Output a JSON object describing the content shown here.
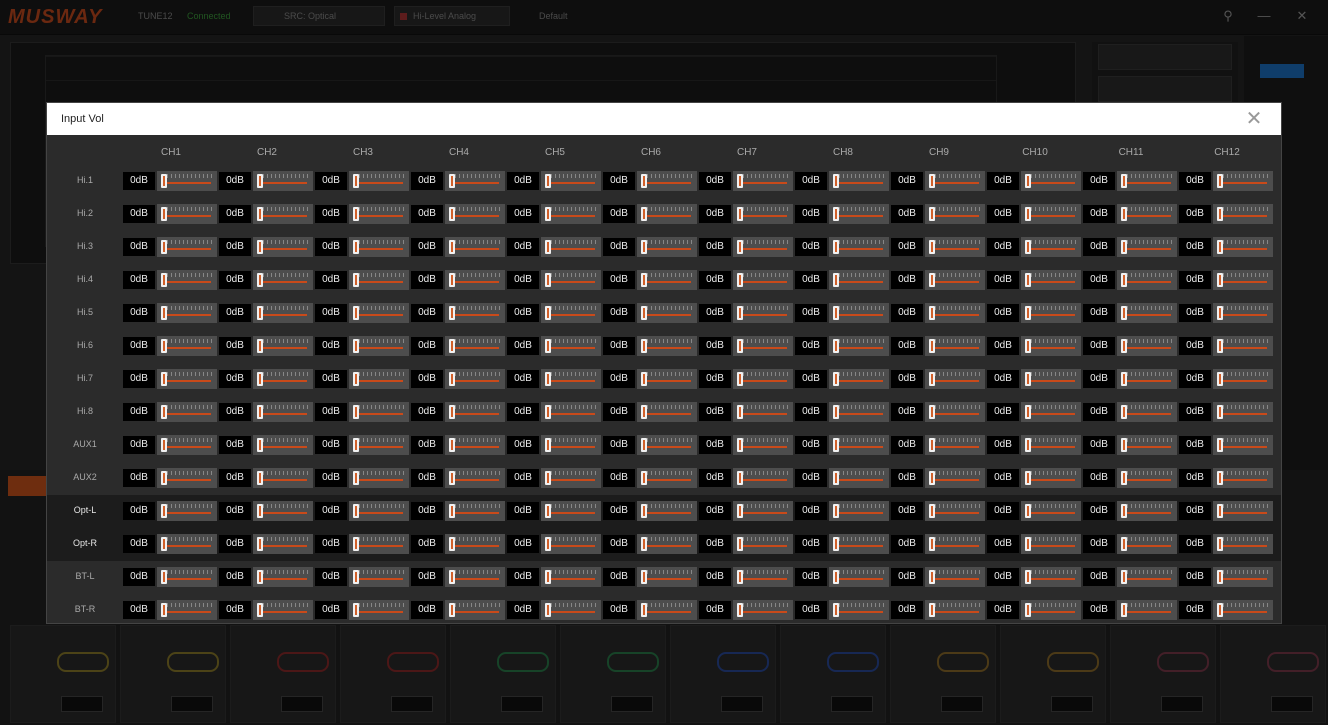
{
  "app": {
    "logo": "MUSWAY",
    "model": "TUNE12",
    "status": "Connected",
    "source": "SRC: Optical",
    "link": "Hi-Level Analog",
    "preset": "Default",
    "colors": {
      "accent": "#c94a1a",
      "connected": "#3c9b3c",
      "modal_header": "#ffffff"
    }
  },
  "modal": {
    "title": "Input Vol",
    "close_icon": "close-icon",
    "columns": [
      "CH1",
      "CH2",
      "CH3",
      "CH4",
      "CH5",
      "CH6",
      "CH7",
      "CH8",
      "CH9",
      "CH10",
      "CH11",
      "CH12"
    ],
    "rows": [
      {
        "label": "Hi.1",
        "value": "0dB",
        "highlight": false
      },
      {
        "label": "Hi.2",
        "value": "0dB",
        "highlight": false
      },
      {
        "label": "Hi.3",
        "value": "0dB",
        "highlight": false
      },
      {
        "label": "Hi.4",
        "value": "0dB",
        "highlight": false
      },
      {
        "label": "Hi.5",
        "value": "0dB",
        "highlight": false
      },
      {
        "label": "Hi.6",
        "value": "0dB",
        "highlight": false
      },
      {
        "label": "Hi.7",
        "value": "0dB",
        "highlight": false
      },
      {
        "label": "Hi.8",
        "value": "0dB",
        "highlight": false
      },
      {
        "label": "AUX1",
        "value": "0dB",
        "highlight": false
      },
      {
        "label": "AUX2",
        "value": "0dB",
        "highlight": false
      },
      {
        "label": "Opt-L",
        "value": "0dB",
        "highlight": true
      },
      {
        "label": "Opt-R",
        "value": "0dB",
        "highlight": true
      },
      {
        "label": "BT-L",
        "value": "0dB",
        "highlight": false
      },
      {
        "label": "BT-R",
        "value": "0dB",
        "highlight": false
      }
    ],
    "fader_level": 0
  }
}
